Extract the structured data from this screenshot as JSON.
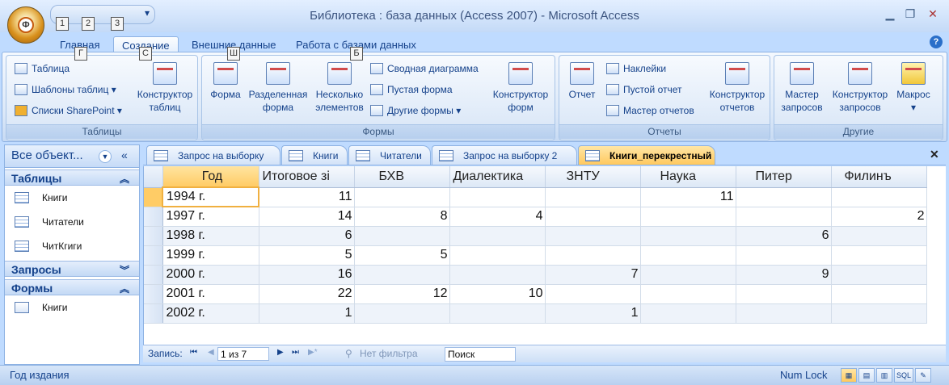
{
  "window": {
    "title": "Библиотека : база данных (Access 2007) - Microsoft Access",
    "office_button_tip": "Ф"
  },
  "qat": {
    "keytips": [
      "1",
      "2",
      "3"
    ]
  },
  "ribbon_tabs": [
    {
      "label": "Главная",
      "keytip": "Г"
    },
    {
      "label": "Создание",
      "keytip": "С"
    },
    {
      "label": "Внешние данные",
      "keytip": "Ш"
    },
    {
      "label": "Работа с базами данных",
      "keytip": "Б"
    }
  ],
  "ribbon": {
    "tables": {
      "title": "Таблицы",
      "table": "Таблица",
      "templates": "Шаблоны таблиц",
      "sharepoint": "Списки SharePoint",
      "designer": [
        "Конструктор",
        "таблиц"
      ]
    },
    "forms": {
      "title": "Формы",
      "form": "Форма",
      "split": [
        "Разделенная",
        "форма"
      ],
      "multi": [
        "Несколько",
        "элементов"
      ],
      "pivot_chart": "Сводная диаграмма",
      "blank_form": "Пустая форма",
      "other_forms": "Другие формы",
      "designer": [
        "Конструктор",
        "форм"
      ]
    },
    "reports": {
      "title": "Отчеты",
      "report": "Отчет",
      "labels": "Наклейки",
      "blank_report": "Пустой отчет",
      "wizard": "Мастер отчетов",
      "designer": [
        "Конструктор",
        "отчетов"
      ]
    },
    "other": {
      "title": "Другие",
      "query_wizard": [
        "Мастер",
        "запросов"
      ],
      "query_designer": [
        "Конструктор",
        "запросов"
      ],
      "macro": "Макрос"
    }
  },
  "nav": {
    "header": "Все объект...",
    "tables_label": "Таблицы",
    "tables": [
      "Книги",
      "Читатели",
      "ЧитКгиги"
    ],
    "queries_label": "Запросы",
    "forms_label": "Формы",
    "forms": [
      "Книги"
    ]
  },
  "doc_tabs": [
    "Запрос на выборку",
    "Книги",
    "Читатели",
    "Запрос на выборку 2",
    "Книги_перекрестный"
  ],
  "grid": {
    "columns": [
      "Год",
      "Итоговое зі",
      "БХВ",
      "Диалектика",
      "ЗНТУ",
      "Наука",
      "Питер",
      "Филинъ"
    ],
    "rows": [
      [
        "1994 г.",
        "11",
        "",
        "",
        "",
        "11",
        "",
        ""
      ],
      [
        "1997 г.",
        "14",
        "8",
        "4",
        "",
        "",
        "",
        "2"
      ],
      [
        "1998 г.",
        "6",
        "",
        "",
        "",
        "",
        "6",
        ""
      ],
      [
        "1999 г.",
        "5",
        "5",
        "",
        "",
        "",
        "",
        ""
      ],
      [
        "2000 г.",
        "16",
        "",
        "",
        "7",
        "",
        "9",
        ""
      ],
      [
        "2001 г.",
        "22",
        "12",
        "10",
        "",
        "",
        "",
        ""
      ],
      [
        "2002 г.",
        "1",
        "",
        "",
        "1",
        "",
        "",
        ""
      ]
    ]
  },
  "recnav": {
    "label": "Запись:",
    "position": "1 из 7",
    "filter": "Нет фильтра",
    "search": "Поиск"
  },
  "status": {
    "left": "Год издания",
    "numlock": "Num Lock"
  }
}
